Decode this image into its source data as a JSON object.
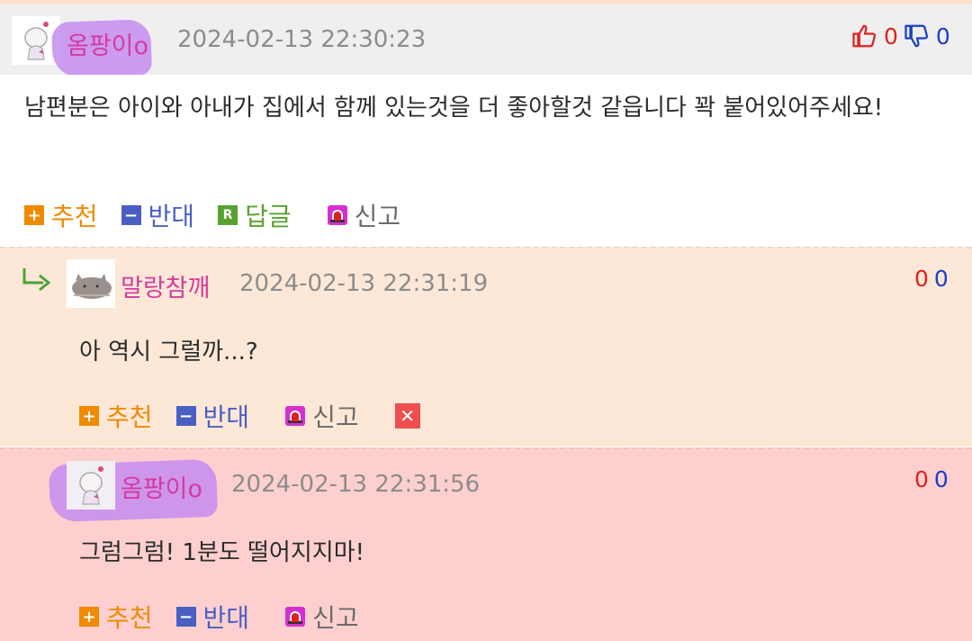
{
  "comments": [
    {
      "nickname": "옴팡이o",
      "datetime": "2024-02-13 22:30:23",
      "up": "0",
      "down": "0",
      "text": "남편분은 아이와 아내가 집에서 함께 있는것을 더 좋아할것 같읍니다 꽉 붙어있어주세요!",
      "actions": {
        "recommend": "추천",
        "oppose": "반대",
        "reply": "답글",
        "report": "신고"
      },
      "reply_icon_letter": "R"
    },
    {
      "nickname": "말랑참깨",
      "datetime": "2024-02-13 22:31:19",
      "up": "0",
      "down": "0",
      "text": "아 역시 그럴까...?",
      "actions": {
        "recommend": "추천",
        "oppose": "반대",
        "report": "신고"
      }
    },
    {
      "nickname": "옴팡이o",
      "datetime": "2024-02-13 22:31:56",
      "up": "0",
      "down": "0",
      "text": "그럼그럼! 1분도 떨어지지마!",
      "actions": {
        "recommend": "추천",
        "oppose": "반대",
        "report": "신고"
      }
    }
  ],
  "icons": {
    "recommend": "plus-icon",
    "oppose": "minus-icon",
    "reply": "reply-icon",
    "report": "siren-icon",
    "delete": "close-icon",
    "thumbs_up": "thumbs-up-icon",
    "thumbs_down": "thumbs-down-icon",
    "reply_arrow": "reply-arrow-icon"
  },
  "colors": {
    "nickname": "#d63a9e",
    "upvote": "#e02020",
    "downvote": "#1a3fc8",
    "recommend": "#f08a00",
    "oppose": "#4a5fc4",
    "reply": "#5aa230",
    "report_icon": "#d62fcf",
    "delete": "#ee4e4e",
    "reply_bg": "#fde8d7",
    "own_reply_bg": "#fdd0cf"
  }
}
